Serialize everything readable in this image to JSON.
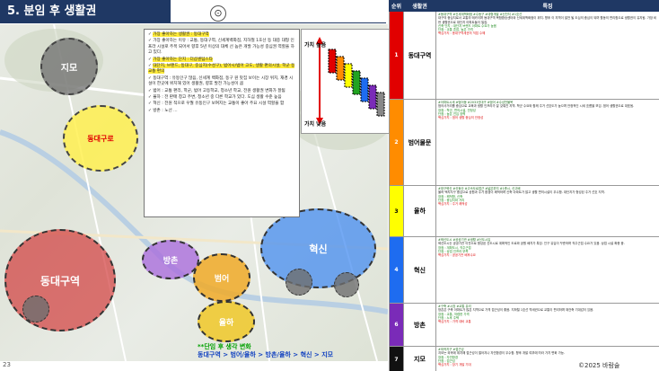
{
  "title": "5. 분임 후 생활권",
  "page_number": "23",
  "copyright": "©2025 바람술",
  "colors": {
    "header": "#1f3864",
    "red": "#e10000",
    "orange": "#ff8c00",
    "yellow": "#ffff00",
    "green": "#21a321",
    "blue": "#1e6cf0",
    "purple": "#7a2bb8",
    "black": "#111111"
  },
  "map": {
    "zones": {
      "jimo": "지모",
      "dongdaegu_top": "동대구로",
      "dongdaegu": "동대구역",
      "bomun": "범어",
      "yulha": "율하",
      "hyeoksin": "혁신",
      "bangchon": "방촌"
    },
    "center_icon": "target-icon"
  },
  "scale": {
    "top_label": "가치 높음",
    "bottom_label": "가치 낮음"
  },
  "info": {
    "p1": "가장 좋아하는 생활권 : 동대구역",
    "p2": "가장 좋아하는 이유 : 교통, 동대구역, 신세계백화점, 지하철 1호선 등 대중 대형 인프라 시설로 주목 되어서 향후 5년 이상의 대체 선 높은 개발 가능성 중심권 역할을 하고 있다.",
    "p3": "가장 좋아하는 단지 : 더샵센텀스타",
    "p4": "대단지, 브랜드, 동대구, 중심지(수성구), 범어시/범어 고도, 생활 편의시설, 학군 등 교통 편의",
    "p5": "동대구역 : 유동인구 많음, 신세계 백화점, 동구 원 맛집 보이는 시장 위치, 재경 시설이 한곳에 위치해 있어 생활권, 향후 발전 가능성이 큼",
    "p6": "범어 : 교통 편리, 학군, 범어 고등학교, 청소년 학교, 전원 생활권 변화가 잘됨",
    "p7": "율하 : 전 판매 창고 주변, 청소년 중 다른 학교가 있다. 도심 생활 수준 높음",
    "p8": "혁신 : 전원 적으로 우월 유동인구 보여지는 교통이 좋아 주요 시설 역할을 함",
    "p9": "방촌 : 노선 ..."
  },
  "note": {
    "line1": "**단임 후 생각 변화",
    "line2": "동대구역 > 범어/율하 > 방촌/율하 > 혁신 > 지모"
  },
  "table": {
    "headers": {
      "rank": "순위",
      "area": "생활권",
      "feature": "특징"
    },
    "rows": [
      {
        "rank": "1",
        "area": "동대구역",
        "color": "#e10000",
        "tags": "#동대구역 #신세계백화점 #수동구 #대형개발 #신천지 #1호선",
        "text": "대구의 중심지로서 교통의 메카이며 동대구역 복합환승센터와 신세계백화점이 위치. 향후 이 지역이 발전 될 도심의 중심이 되며 활동의 편리함으로 생활권이 유지됨. 가장 비싼 생활권으로 대단지 아파트들이 밀집.",
        "pros": "신축 단지 : 대단지 브랜드 아파트 수요가 높음",
        "cons": "단점 : 교통 혼잡, 높은 가격",
        "price": "핵심가치 : 동대구역세권의 직접 수혜"
      },
      {
        "rank": "2",
        "area": "범어물문",
        "color": "#ff8c00",
        "tags": "#아파트시세 #범어동 #2031년대구 #범어 #수성천물목",
        "text": "범어사거리를 중심으로 교육과 생활 인프라가 잘 갖춰진 지역. 학군 수요와 함께 주거 선호도가 높으며 안정적인 시세 흐름을 보임. 범어 생활권으로 대표됨.",
        "pros": "장점 : 학군, 편의시설, 안정성",
        "cons": "단점 : 높은 진입 장벽",
        "price": "핵심가치 : 범어 생활 중심의 안정성"
      },
      {
        "rank": "3",
        "area": "율하",
        "color": "#ffff00",
        "tags": "#대구혁신 #신동산 #고속도로접근 #넓은부지 #1층시, 신고배",
        "text": "율하 택지지구 중심으로 공원과 주거 환경이 쾌적하며 신축 아파트가 많고 생활 편의시설이 우수함. 대단지가 형성된 주거 선호 지역.",
        "pros": "장점 : 쾌적함, 신축",
        "cons": "단점 : 중심지와 거리",
        "price": "핵심가치 : 주거 쾌적성"
      },
      {
        "rank": "4",
        "area": "혁신",
        "color": "#1e6cf0",
        "tags": "#혁신도시 #공공기관 #생활 #신도시입",
        "text": "혁신도시는 공공기관 이전으로 형성된 신도시로 계획적인 도로와 공원 배치가 특징. 인구 유입이 꾸준하며 직주근접 수요가 있음. 상업 시설 확충 중.",
        "pros": "장점 : 계획도시, 직주근접",
        "cons": "단점 : 상업 인프라 부족",
        "price": "핵심가치 : 공공기관 배후수요"
      },
      {
        "rank": "6",
        "area": "방촌",
        "color": "#7a2bb8",
        "tags": "#구축 #시장 #교통 유리",
        "text": "방촌은 구축 아파트가 많은 지역으로 가격 접근성이 좋음. 지하철 1호선 역세권으로 교통이 편리하며 재건축 기대감이 있음.",
        "pros": "장점 : 교통, 저렴한 가격",
        "cons": "단점 : 노후 주택",
        "price": "핵심가치 : 가격 대비 교통"
      },
      {
        "rank": "7",
        "area": "지모",
        "color": "#111111",
        "tags": "#외곽지구 #접근성",
        "text": "지모는 외곽에 위치해 접근성이 떨어지나 자연환경이 우수함. 향후 개발 여부에 따라 가치 변화 가능.",
        "pros": "장점 : 자연환경",
        "cons": "단점 : 접근성",
        "price": "핵심가치 : 장기 개발 기대"
      }
    ]
  }
}
